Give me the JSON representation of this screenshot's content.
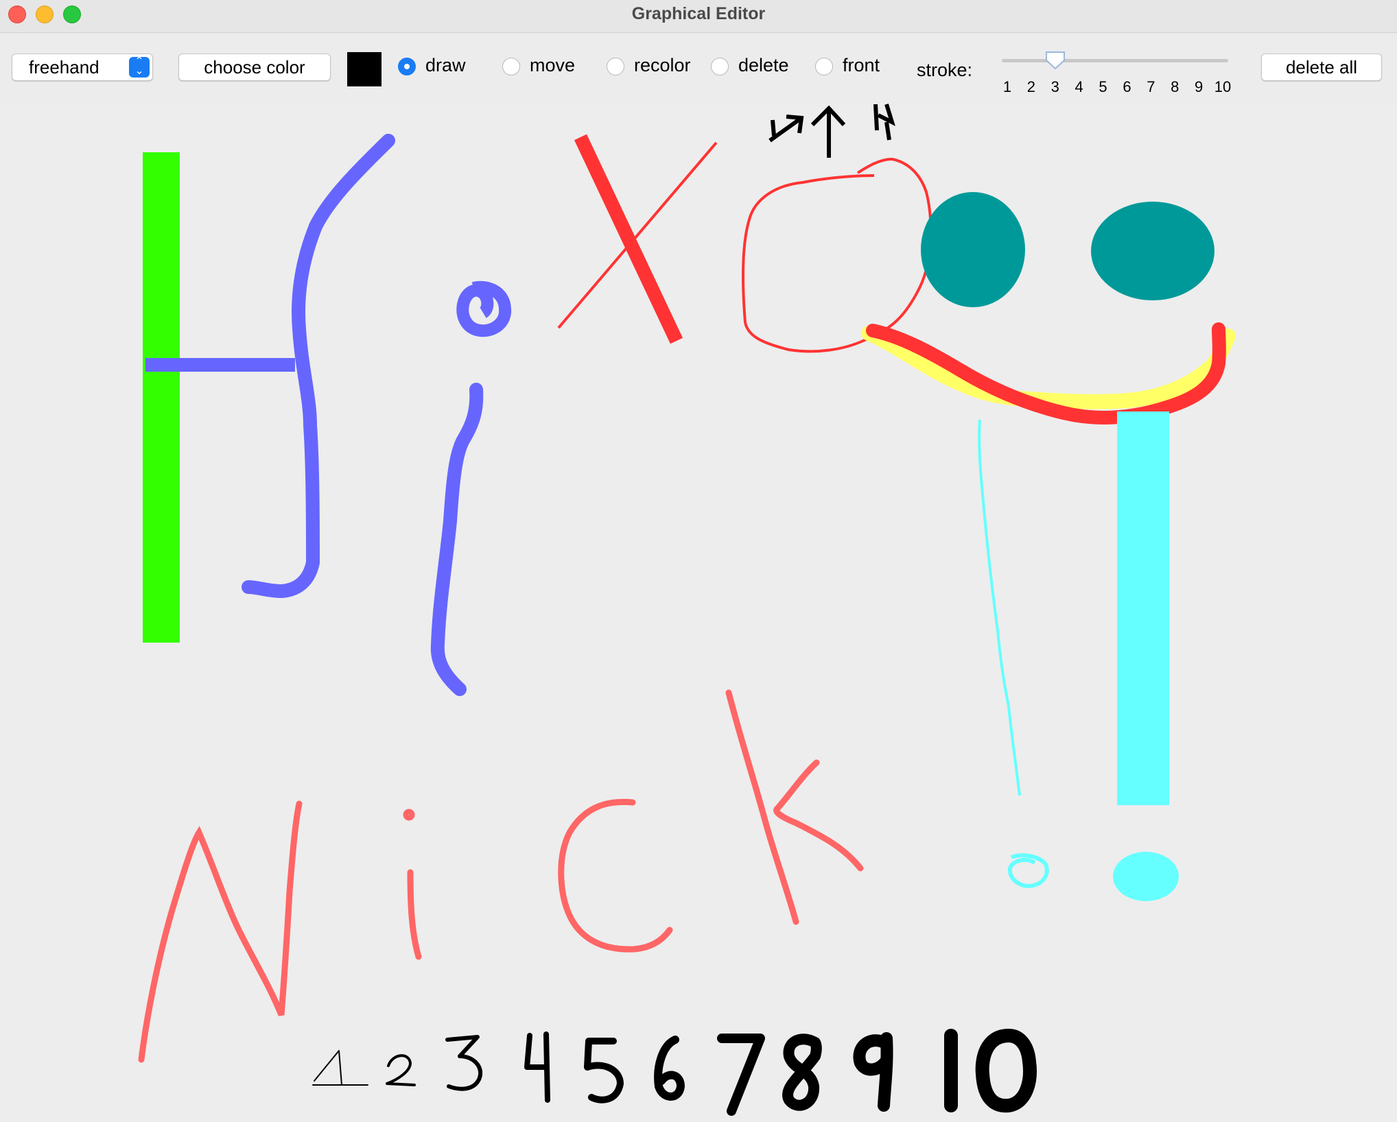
{
  "window": {
    "title": "Graphical Editor"
  },
  "toolbar": {
    "shape_select": {
      "value": "freehand",
      "icon": "up-down-chevron-icon"
    },
    "choose_color_label": "choose color",
    "current_color": "#000000",
    "modes": [
      {
        "label": "draw",
        "checked": true
      },
      {
        "label": "move",
        "checked": false
      },
      {
        "label": "recolor",
        "checked": false
      },
      {
        "label": "delete",
        "checked": false
      },
      {
        "label": "front",
        "checked": false
      }
    ],
    "stroke_label": "stroke:",
    "stroke": {
      "value": 3,
      "min": 1,
      "max": 10,
      "ticks": [
        "1",
        "2",
        "3",
        "4",
        "5",
        "6",
        "7",
        "8",
        "9",
        "10"
      ]
    },
    "delete_all_label": "delete all"
  },
  "canvas": {
    "background": "#ededed",
    "colors": {
      "green": "#33ff00",
      "blue": "#6666ff",
      "red": "#ff3333",
      "teal": "#009999",
      "yellow": "#ffff66",
      "cyan": "#66ffff",
      "salmon": "#ff6666",
      "black": "#000000"
    }
  }
}
